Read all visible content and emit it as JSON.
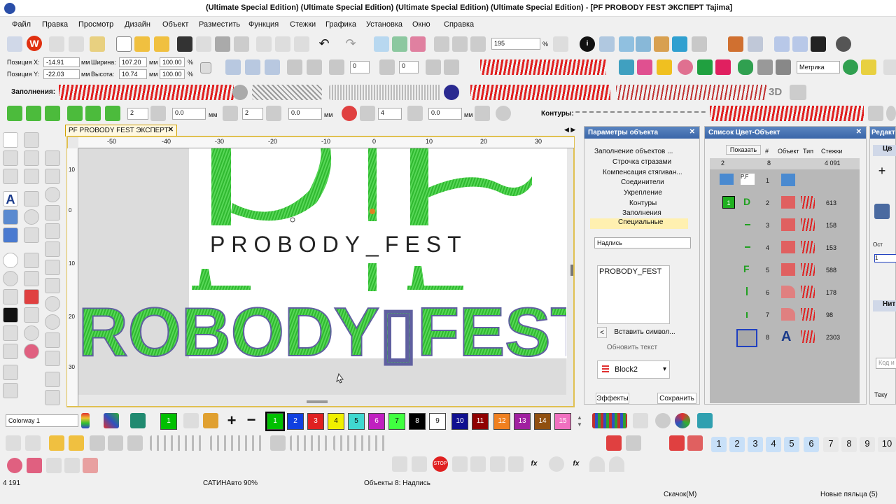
{
  "window": {
    "title": "(Ultimate Special Edition) (Ultimate Special Edition) (Ultimate Special Edition) (Ultimate Special Edition) - [PF PROBODY FEST  ЭКСПЕРТ         Tajima]"
  },
  "menu": [
    "Файл",
    "Правка",
    "Просмотр",
    "Дизайн",
    "Объект",
    "Разместить",
    "Функция",
    "Стежки",
    "Графика",
    "Установка",
    "Окно",
    "Справка"
  ],
  "toolbar": {
    "zoom_value": "195",
    "zoom_unit": "%"
  },
  "position": {
    "pos_x_label": "Позиция X:",
    "pos_x": "-14.91",
    "pos_y_label": "Позиция Y:",
    "pos_y": "-22.03",
    "unit": "мм",
    "width_label": "Ширина:",
    "width": "107.20",
    "height_label": "Высота:",
    "height": "10.74",
    "scale_w": "100.00",
    "scale_h": "100.00",
    "pct": "%",
    "rot1": "0",
    "rot2": "0",
    "units_select": "Метрика"
  },
  "fills_bar": {
    "label": "Заполнения:",
    "three_d": "3D"
  },
  "transform_bar": {
    "v1": "2",
    "v2": "0.0",
    "v3": "2",
    "v4": "0.0",
    "v5": "4",
    "v6": "0.0",
    "unit": "мм",
    "contours_label": "Контуры:"
  },
  "document_tab": {
    "label": "PF PROBODY FEST  ЭКСПЕРТ",
    "close": "✕"
  },
  "ruler_top": [
    "-50",
    "-40",
    "-30",
    "-20",
    "-10",
    "0",
    "10",
    "20",
    "30"
  ],
  "ruler_left": [
    "10",
    "0",
    "10",
    "20",
    "30"
  ],
  "design": {
    "caption_text": "PROBODY_FEST",
    "embroidery_text": "ROBODY▯FEST"
  },
  "object_params": {
    "title": "Параметры объекта",
    "tree": [
      "Заполнение объектов ...",
      "Строчка стразами",
      "Компенсация стягиван...",
      "Соединители",
      "Укрепление",
      "Контуры",
      "Заполнения",
      "Специальные"
    ],
    "selected_index": 7,
    "field_label": "Надпись",
    "text_value": "PROBODY_FEST",
    "insert_symbol": "Вставить символ...",
    "update_text": "Обновить текст",
    "font": "Block2",
    "effects": "Эффекты",
    "save": "Сохранить"
  },
  "color_object_list": {
    "title": "Список Цвет-Объект",
    "headers": {
      "show": "Показать",
      "num": "#",
      "obj": "Объект",
      "type": "Тип",
      "stitches": "Стежки"
    },
    "summary": {
      "count": "2",
      "objects": "8",
      "total": "4 091"
    },
    "rows": [
      {
        "num": "1",
        "stitches": ""
      },
      {
        "num": "2",
        "stitches": "613",
        "color_label": "1"
      },
      {
        "num": "3",
        "stitches": "158"
      },
      {
        "num": "4",
        "stitches": "153"
      },
      {
        "num": "5",
        "stitches": "588"
      },
      {
        "num": "6",
        "stitches": "178"
      },
      {
        "num": "7",
        "stitches": "98"
      },
      {
        "num": "8",
        "stitches": "2303"
      }
    ]
  },
  "right_panel": {
    "title": "Редакт",
    "label1": "Цв",
    "label2": "Ост",
    "label3": "Нит",
    "label4": "Код и",
    "label5": "Теку"
  },
  "colorway": {
    "value": "Colorway 1"
  },
  "swatches": [
    {
      "label": "1",
      "color": "#00c000"
    },
    {
      "label": "2",
      "color": "#1040e0"
    },
    {
      "label": "3",
      "color": "#e02020"
    },
    {
      "label": "4",
      "color": "#f0f000"
    },
    {
      "label": "5",
      "color": "#40d8d0"
    },
    {
      "label": "6",
      "color": "#c020c0"
    },
    {
      "label": "7",
      "color": "#40ff40"
    },
    {
      "label": "8",
      "color": "#000000"
    },
    {
      "label": "9",
      "color": "#ffffff"
    },
    {
      "label": "10",
      "color": "#101090"
    },
    {
      "label": "11",
      "color": "#900000"
    },
    {
      "label": "12",
      "color": "#f08020"
    },
    {
      "label": "13",
      "color": "#a020a0"
    },
    {
      "label": "14",
      "color": "#905010"
    },
    {
      "label": "15",
      "color": "#f070c0"
    }
  ],
  "needle_numbers": [
    "1",
    "2",
    "3",
    "4",
    "5",
    "6",
    "7",
    "8",
    "9",
    "10"
  ],
  "status": {
    "stitch_count": "4 191",
    "fill_type": "САТИНАвто 90%",
    "objects": "Объекты 8: Надпись",
    "jump": "Скачок(М)",
    "hoop": "Новые пяльца (5)"
  }
}
